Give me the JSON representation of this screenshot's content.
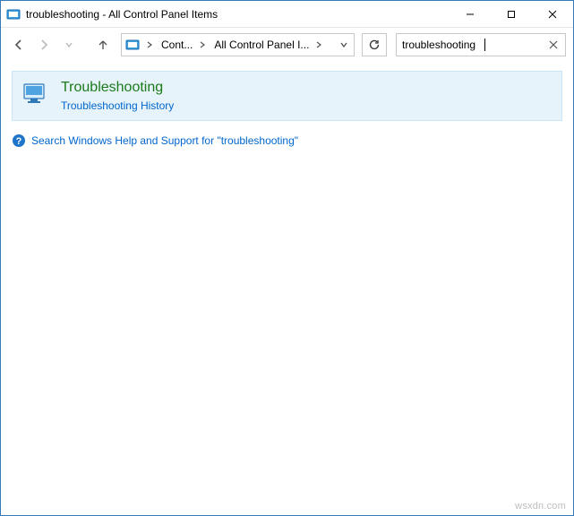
{
  "titlebar": {
    "title": "troubleshooting - All Control Panel Items"
  },
  "nav": {
    "breadcrumbs": [
      "Cont...",
      "All Control Panel I..."
    ]
  },
  "search": {
    "value": "troubleshooting"
  },
  "result": {
    "title": "Troubleshooting",
    "subtitle": "Troubleshooting History"
  },
  "help": {
    "link_text": "Search Windows Help and Support for \"troubleshooting\""
  },
  "watermark": "wsxdn.com"
}
